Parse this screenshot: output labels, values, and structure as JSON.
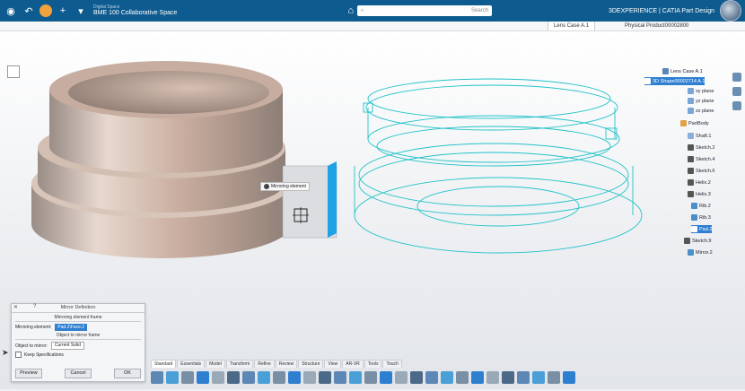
{
  "topbar": {
    "space_label": "Digital Space",
    "space_value": "BME 100 Collaborative Space",
    "search_placeholder": "Search",
    "brand": "3DEXPERIENCE | CATIA Part Design"
  },
  "tabs": [
    {
      "label": "Lens Case A.1",
      "active": true
    },
    {
      "label": "Physical Product00002800",
      "active": false
    }
  ],
  "tree": {
    "items": [
      {
        "label": "Lens Case A.1",
        "icon_color": "#5b86b5"
      },
      {
        "label": "3D Shape00002714 A.1",
        "icon_color": "#5b86b5",
        "selected": true
      },
      {
        "label": "xy plane",
        "icon_color": "#7aa6d6"
      },
      {
        "label": "yz plane",
        "icon_color": "#7aa6d6"
      },
      {
        "label": "zx plane",
        "icon_color": "#7aa6d6"
      },
      {
        "label": "PartBody",
        "icon_color": "#e0a244"
      },
      {
        "label": "Shaft.1",
        "icon_color": "#8ab0d8"
      },
      {
        "label": "Sketch.2",
        "icon_color": "#555555"
      },
      {
        "label": "Sketch.4",
        "icon_color": "#555555"
      },
      {
        "label": "Sketch.6",
        "icon_color": "#555555"
      },
      {
        "label": "Helix.2",
        "icon_color": "#555555"
      },
      {
        "label": "Helix.3",
        "icon_color": "#555555"
      },
      {
        "label": "Rib.2",
        "icon_color": "#4a8fc8"
      },
      {
        "label": "Rib.3",
        "icon_color": "#4a8fc8"
      },
      {
        "label": "Pad.2",
        "icon_color": "#2f7fd1"
      },
      {
        "label": "Sketch.9",
        "icon_color": "#555555"
      },
      {
        "label": "Mirror.2",
        "icon_color": "#4a8fc8"
      }
    ]
  },
  "tooltip": "Mirroring element",
  "dialog": {
    "title": "Mirror Definition",
    "section1": "Mirroring element frame",
    "mirroring_label": "Mirroring element:",
    "mirroring_value": "Pad.2\\Face.2",
    "section2": "Object to mirror frame",
    "object_label": "Object to mirror:",
    "object_value": "Current Solid",
    "check_label": "Keep Specifications",
    "buttons": {
      "preview": "Preview",
      "cancel": "Cancel",
      "ok": "OK"
    }
  },
  "actionbar": {
    "tabs": [
      "Standard",
      "Essentials",
      "Model",
      "Transform",
      "Refine",
      "Review",
      "Structure",
      "View",
      "AR-VR",
      "Tools",
      "Touch"
    ],
    "active_tab": "Standard",
    "icon_count": 28
  },
  "colors": {
    "topbar": "#0e5b8f",
    "selection": "#2f7fd1",
    "wireframe": "#22c3c9",
    "part": "#c9a694"
  }
}
